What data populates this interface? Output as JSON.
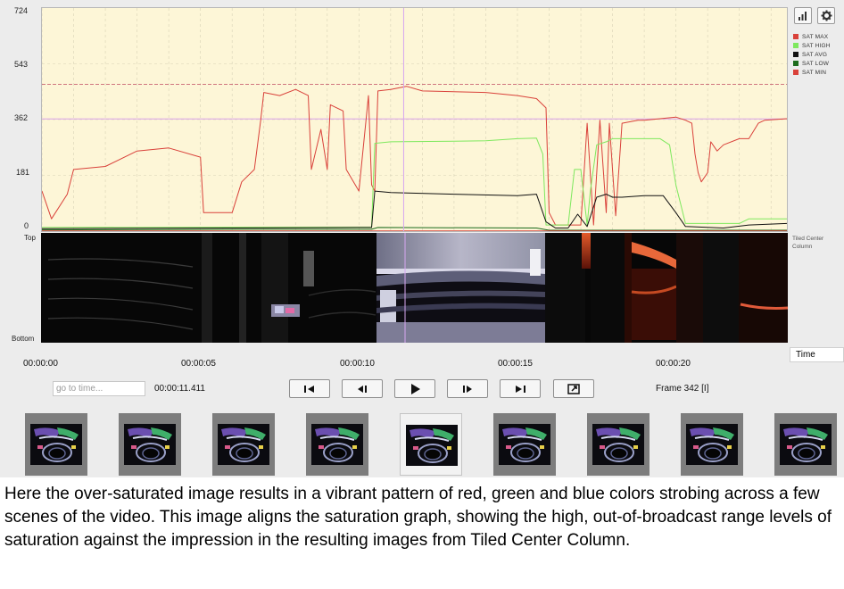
{
  "graph": {
    "y_ticks": [
      "724",
      "543",
      "362",
      "181",
      "0"
    ],
    "legend": [
      {
        "label": "SAT MAX",
        "color": "#d9413a"
      },
      {
        "label": "SAT HIGH",
        "color": "#7ee85e"
      },
      {
        "label": "SAT AVG",
        "color": "#111111"
      },
      {
        "label": "SAT LOW",
        "color": "#1c6b1c"
      },
      {
        "label": "SAT MIN",
        "color": "#d9413a"
      }
    ],
    "toolbar": {
      "chart_icon": "bar-chart-icon",
      "settings_icon": "gear-icon"
    }
  },
  "tile_view": {
    "top_label": "Top",
    "bottom_label": "Bottom",
    "view_name": "Tiled Center Column"
  },
  "timeline": {
    "ticks": [
      "00:00:00",
      "00:00:05",
      "00:00:10",
      "00:00:15",
      "00:00:20"
    ],
    "unit_select": "Time"
  },
  "transport": {
    "goto_placeholder": "go to time...",
    "current_time": "00:00:11.411",
    "frame_label": "Frame 342 [I]",
    "buttons": [
      {
        "name": "go-to-start-button",
        "icon": "skip-start-icon"
      },
      {
        "name": "step-back-button",
        "icon": "step-back-icon"
      },
      {
        "name": "play-button",
        "icon": "play-icon"
      },
      {
        "name": "step-forward-button",
        "icon": "step-forward-icon"
      },
      {
        "name": "go-to-end-button",
        "icon": "skip-end-icon"
      },
      {
        "name": "export-frame-button",
        "icon": "export-icon"
      }
    ]
  },
  "thumbnails": {
    "count": 9,
    "selected_index": 4
  },
  "caption": "Here the over-saturated image results in a vibrant pattern of red, green and blue colors strobing across a few scenes of the video. This image aligns the saturation graph, showing the high, out-of-broadcast range levels of saturation against the impression in the resulting images from Tiled Center Column.",
  "chart_data": {
    "type": "line",
    "x_unit": "seconds",
    "xlim": [
      0,
      23.5
    ],
    "ylim": [
      0,
      724
    ],
    "grid": true,
    "reference_lines": [
      476,
      364
    ],
    "playhead_time": 11.411,
    "series": [
      {
        "name": "SAT MAX",
        "color": "#d9413a",
        "points": [
          [
            0,
            130
          ],
          [
            0.3,
            40
          ],
          [
            0.8,
            120
          ],
          [
            1,
            200
          ],
          [
            2,
            210
          ],
          [
            3,
            260
          ],
          [
            4,
            270
          ],
          [
            5,
            240
          ],
          [
            5.1,
            60
          ],
          [
            6,
            60
          ],
          [
            6.3,
            160
          ],
          [
            6.7,
            200
          ],
          [
            6.9,
            360
          ],
          [
            7,
            450
          ],
          [
            7.5,
            440
          ],
          [
            8,
            460
          ],
          [
            8.4,
            440
          ],
          [
            8.5,
            200
          ],
          [
            8.8,
            330
          ],
          [
            9,
            200
          ],
          [
            9.1,
            410
          ],
          [
            9.5,
            390
          ],
          [
            9.6,
            200
          ],
          [
            10,
            130
          ],
          [
            10.3,
            440
          ],
          [
            10.4,
            150
          ],
          [
            10.5,
            130
          ],
          [
            10.6,
            455
          ],
          [
            11,
            460
          ],
          [
            11.5,
            470
          ],
          [
            12,
            455
          ],
          [
            14,
            450
          ],
          [
            15,
            440
          ],
          [
            15.6,
            430
          ],
          [
            15.9,
            400
          ],
          [
            16,
            60
          ],
          [
            16.2,
            20
          ],
          [
            17,
            20
          ],
          [
            17.2,
            350
          ],
          [
            17.4,
            20
          ],
          [
            17.6,
            360
          ],
          [
            17.8,
            60
          ],
          [
            17.9,
            350
          ],
          [
            18.1,
            50
          ],
          [
            18.3,
            350
          ],
          [
            18.8,
            360
          ],
          [
            19,
            360
          ],
          [
            20,
            370
          ],
          [
            20.3,
            360
          ],
          [
            20.5,
            350
          ],
          [
            20.6,
            250
          ],
          [
            20.7,
            190
          ],
          [
            20.8,
            160
          ],
          [
            21,
            190
          ],
          [
            21.1,
            290
          ],
          [
            21.3,
            260
          ],
          [
            21.5,
            280
          ],
          [
            22,
            300
          ],
          [
            22.3,
            300
          ],
          [
            22.6,
            350
          ],
          [
            22.8,
            360
          ],
          [
            23.5,
            365
          ]
        ]
      },
      {
        "name": "SAT HIGH",
        "color": "#7ee85e",
        "points": [
          [
            0,
            12
          ],
          [
            10.4,
            13
          ],
          [
            10.5,
            285
          ],
          [
            11,
            290
          ],
          [
            13,
            292
          ],
          [
            14,
            293
          ],
          [
            15,
            300
          ],
          [
            15.6,
            302
          ],
          [
            15.8,
            250
          ],
          [
            15.9,
            20
          ],
          [
            16.6,
            20
          ],
          [
            16.8,
            200
          ],
          [
            17,
            200
          ],
          [
            17.2,
            20
          ],
          [
            17.3,
            130
          ],
          [
            17.5,
            280
          ],
          [
            17.8,
            290
          ],
          [
            18,
            300
          ],
          [
            18.3,
            300
          ],
          [
            18.5,
            300
          ],
          [
            19.5,
            300
          ],
          [
            19.8,
            280
          ],
          [
            20,
            150
          ],
          [
            20.3,
            25
          ],
          [
            21,
            25
          ],
          [
            22,
            25
          ],
          [
            22.3,
            40
          ],
          [
            23.5,
            40
          ]
        ]
      },
      {
        "name": "SAT AVG",
        "color": "#111111",
        "points": [
          [
            0,
            8
          ],
          [
            6,
            10
          ],
          [
            10,
            12
          ],
          [
            10.4,
            12
          ],
          [
            10.5,
            130
          ],
          [
            11,
            125
          ],
          [
            13,
            120
          ],
          [
            15,
            115
          ],
          [
            15.6,
            120
          ],
          [
            15.9,
            30
          ],
          [
            16.2,
            10
          ],
          [
            16.6,
            10
          ],
          [
            16.9,
            55
          ],
          [
            17.2,
            15
          ],
          [
            17.5,
            110
          ],
          [
            17.8,
            120
          ],
          [
            18,
            110
          ],
          [
            18.3,
            110
          ],
          [
            19,
            115
          ],
          [
            19.6,
            115
          ],
          [
            20,
            60
          ],
          [
            20.3,
            15
          ],
          [
            21.5,
            10
          ],
          [
            22.3,
            20
          ],
          [
            23.5,
            25
          ]
        ]
      },
      {
        "name": "SAT LOW",
        "color": "#1c6b1c",
        "points": [
          [
            0,
            4
          ],
          [
            7,
            6
          ],
          [
            10.4,
            6
          ],
          [
            10.6,
            12
          ],
          [
            15.6,
            10
          ],
          [
            16,
            3
          ],
          [
            23.5,
            3
          ]
        ]
      },
      {
        "name": "SAT MIN",
        "color": "#d9413a",
        "points": [
          [
            0,
            1
          ],
          [
            23.5,
            1
          ]
        ]
      }
    ]
  }
}
